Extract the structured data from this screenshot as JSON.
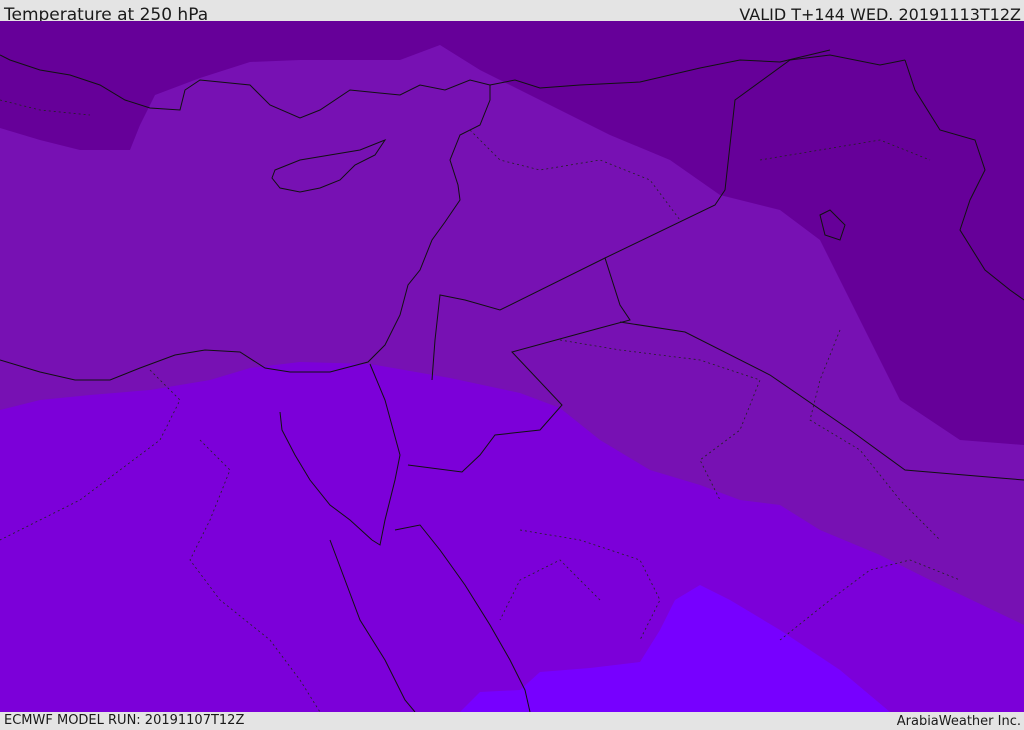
{
  "header": {
    "title": "Temperature at 250 hPa",
    "valid": "VALID T+144 WED. 20191113T12Z"
  },
  "footer": {
    "model_run": "ECMWF MODEL RUN: 20191107T12Z",
    "credit": "ArabiaWeather Inc."
  },
  "map": {
    "colors": {
      "band_coldest": "#660099",
      "band_cold": "#7711b3",
      "band_mid": "#7c00d9",
      "band_warm": "#7700ff",
      "border": "#111111"
    }
  }
}
